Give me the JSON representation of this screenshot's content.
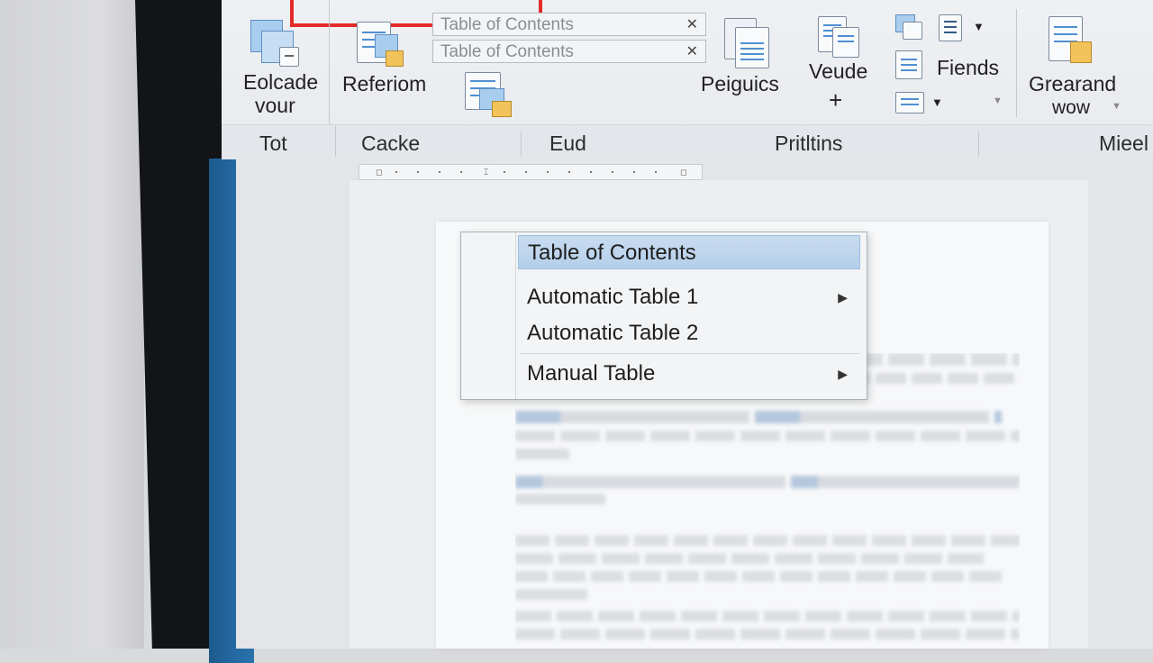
{
  "ribbon": {
    "top_field_1": "Table of Contents",
    "top_field_2": "Table of Contents",
    "btn_encade": [
      "Eolcade",
      "vour"
    ],
    "btn_referiom": "Referiom",
    "btn_peiguics": "Peiguics",
    "btn_veude": "Veude",
    "btn_fiends": "Fiends",
    "btn_grearand": [
      "Grearand",
      "wow"
    ],
    "groups": [
      "Tot",
      "Cacke",
      "Eud",
      "Pritltins",
      "Mieel"
    ]
  },
  "menu": {
    "items": [
      {
        "label": "Table of Contents",
        "selected": true,
        "submenu": false
      },
      {
        "label": "Automatic Table 1",
        "selected": false,
        "submenu": true
      },
      {
        "label": "Automatic Table 2",
        "selected": false,
        "submenu": false
      },
      {
        "label": "Manual Table",
        "selected": false,
        "submenu": true
      }
    ]
  },
  "colors": {
    "highlight_box": "#e52a2a",
    "selection": "#b4cfea",
    "accent_blue": "#246aa3"
  },
  "icons": [
    "building-blocks-icon",
    "insert-field-icon",
    "table-icon",
    "document-lines-icon",
    "caret-down-icon",
    "close-icon",
    "chevron-right-icon"
  ]
}
